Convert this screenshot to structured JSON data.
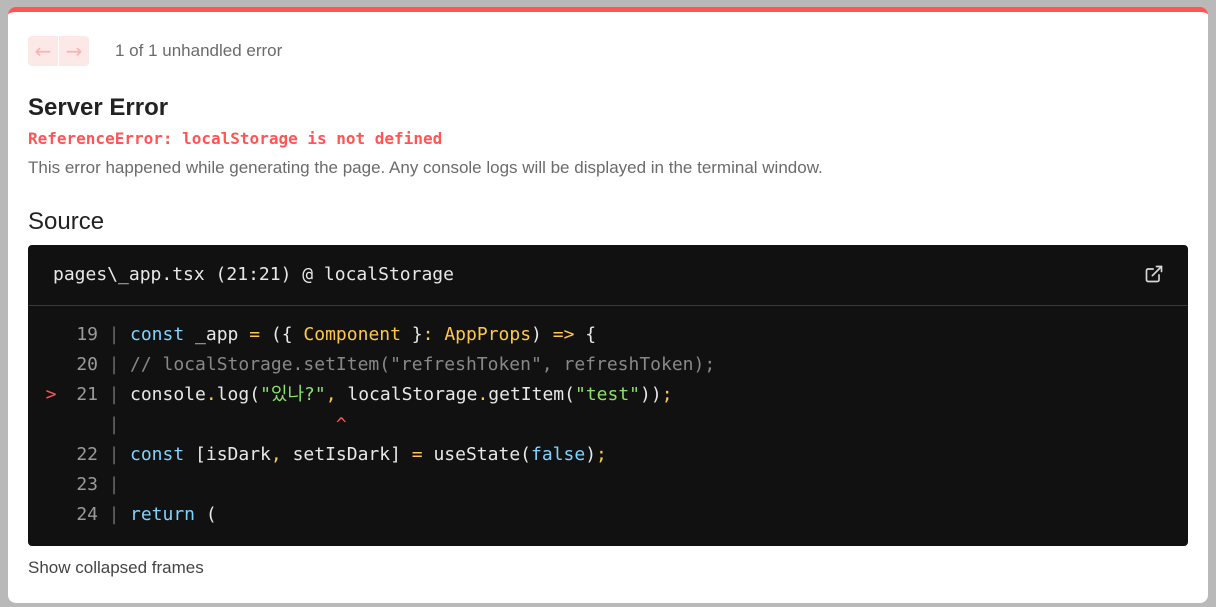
{
  "nav": {
    "prev_icon": "arrow-left-icon",
    "next_icon": "arrow-right-icon",
    "count_text": "1 of 1 unhandled error"
  },
  "error": {
    "title": "Server Error",
    "message": "ReferenceError: localStorage is not defined",
    "description": "This error happened while generating the page. Any console logs will be displayed in the terminal window."
  },
  "source": {
    "heading": "Source",
    "file_label": "pages\\_app.tsx (21:21) @ localStorage",
    "open_icon": "external-link-icon",
    "lines": {
      "l19": {
        "num": "19",
        "t1": "const",
        "t2": " _app ",
        "t3": "=",
        "t4": " ({ ",
        "t5": "Component",
        "t6": " }",
        "t7": ":",
        "t8": " ",
        "t9": "AppProps",
        "t10": ") ",
        "t11": "=>",
        "t12": " {"
      },
      "l20": {
        "num": "20",
        "t1": "// localStorage.setItem(\"refreshToken\", refreshToken);"
      },
      "l21": {
        "marker": ">",
        "num": "21",
        "t1": "console",
        "t2": ".",
        "t3": "log(",
        "t4": "\"있나?\"",
        "t5": ",",
        "t6": " localStorage",
        "t7": ".",
        "t8": "getItem(",
        "t9": "\"test\"",
        "t10": "))",
        "t11": ";"
      },
      "caret": {
        "text": "^"
      },
      "l22": {
        "num": "22",
        "t1": "const",
        "t2": " [isDark",
        "t3": ",",
        "t4": " setIsDark] ",
        "t5": "=",
        "t6": " useState(",
        "t7": "false",
        "t8": ")",
        "t9": ";"
      },
      "l23": {
        "num": "23"
      },
      "l24": {
        "num": "24",
        "t1": "return",
        "t2": " ("
      }
    }
  },
  "footer": {
    "collapsed_label": "Show collapsed frames"
  },
  "colors": {
    "accent": "#ff5555",
    "code_bg": "#111111",
    "keyword": "#7fd3ff",
    "type": "#ffc947",
    "string": "#8ae26a"
  }
}
